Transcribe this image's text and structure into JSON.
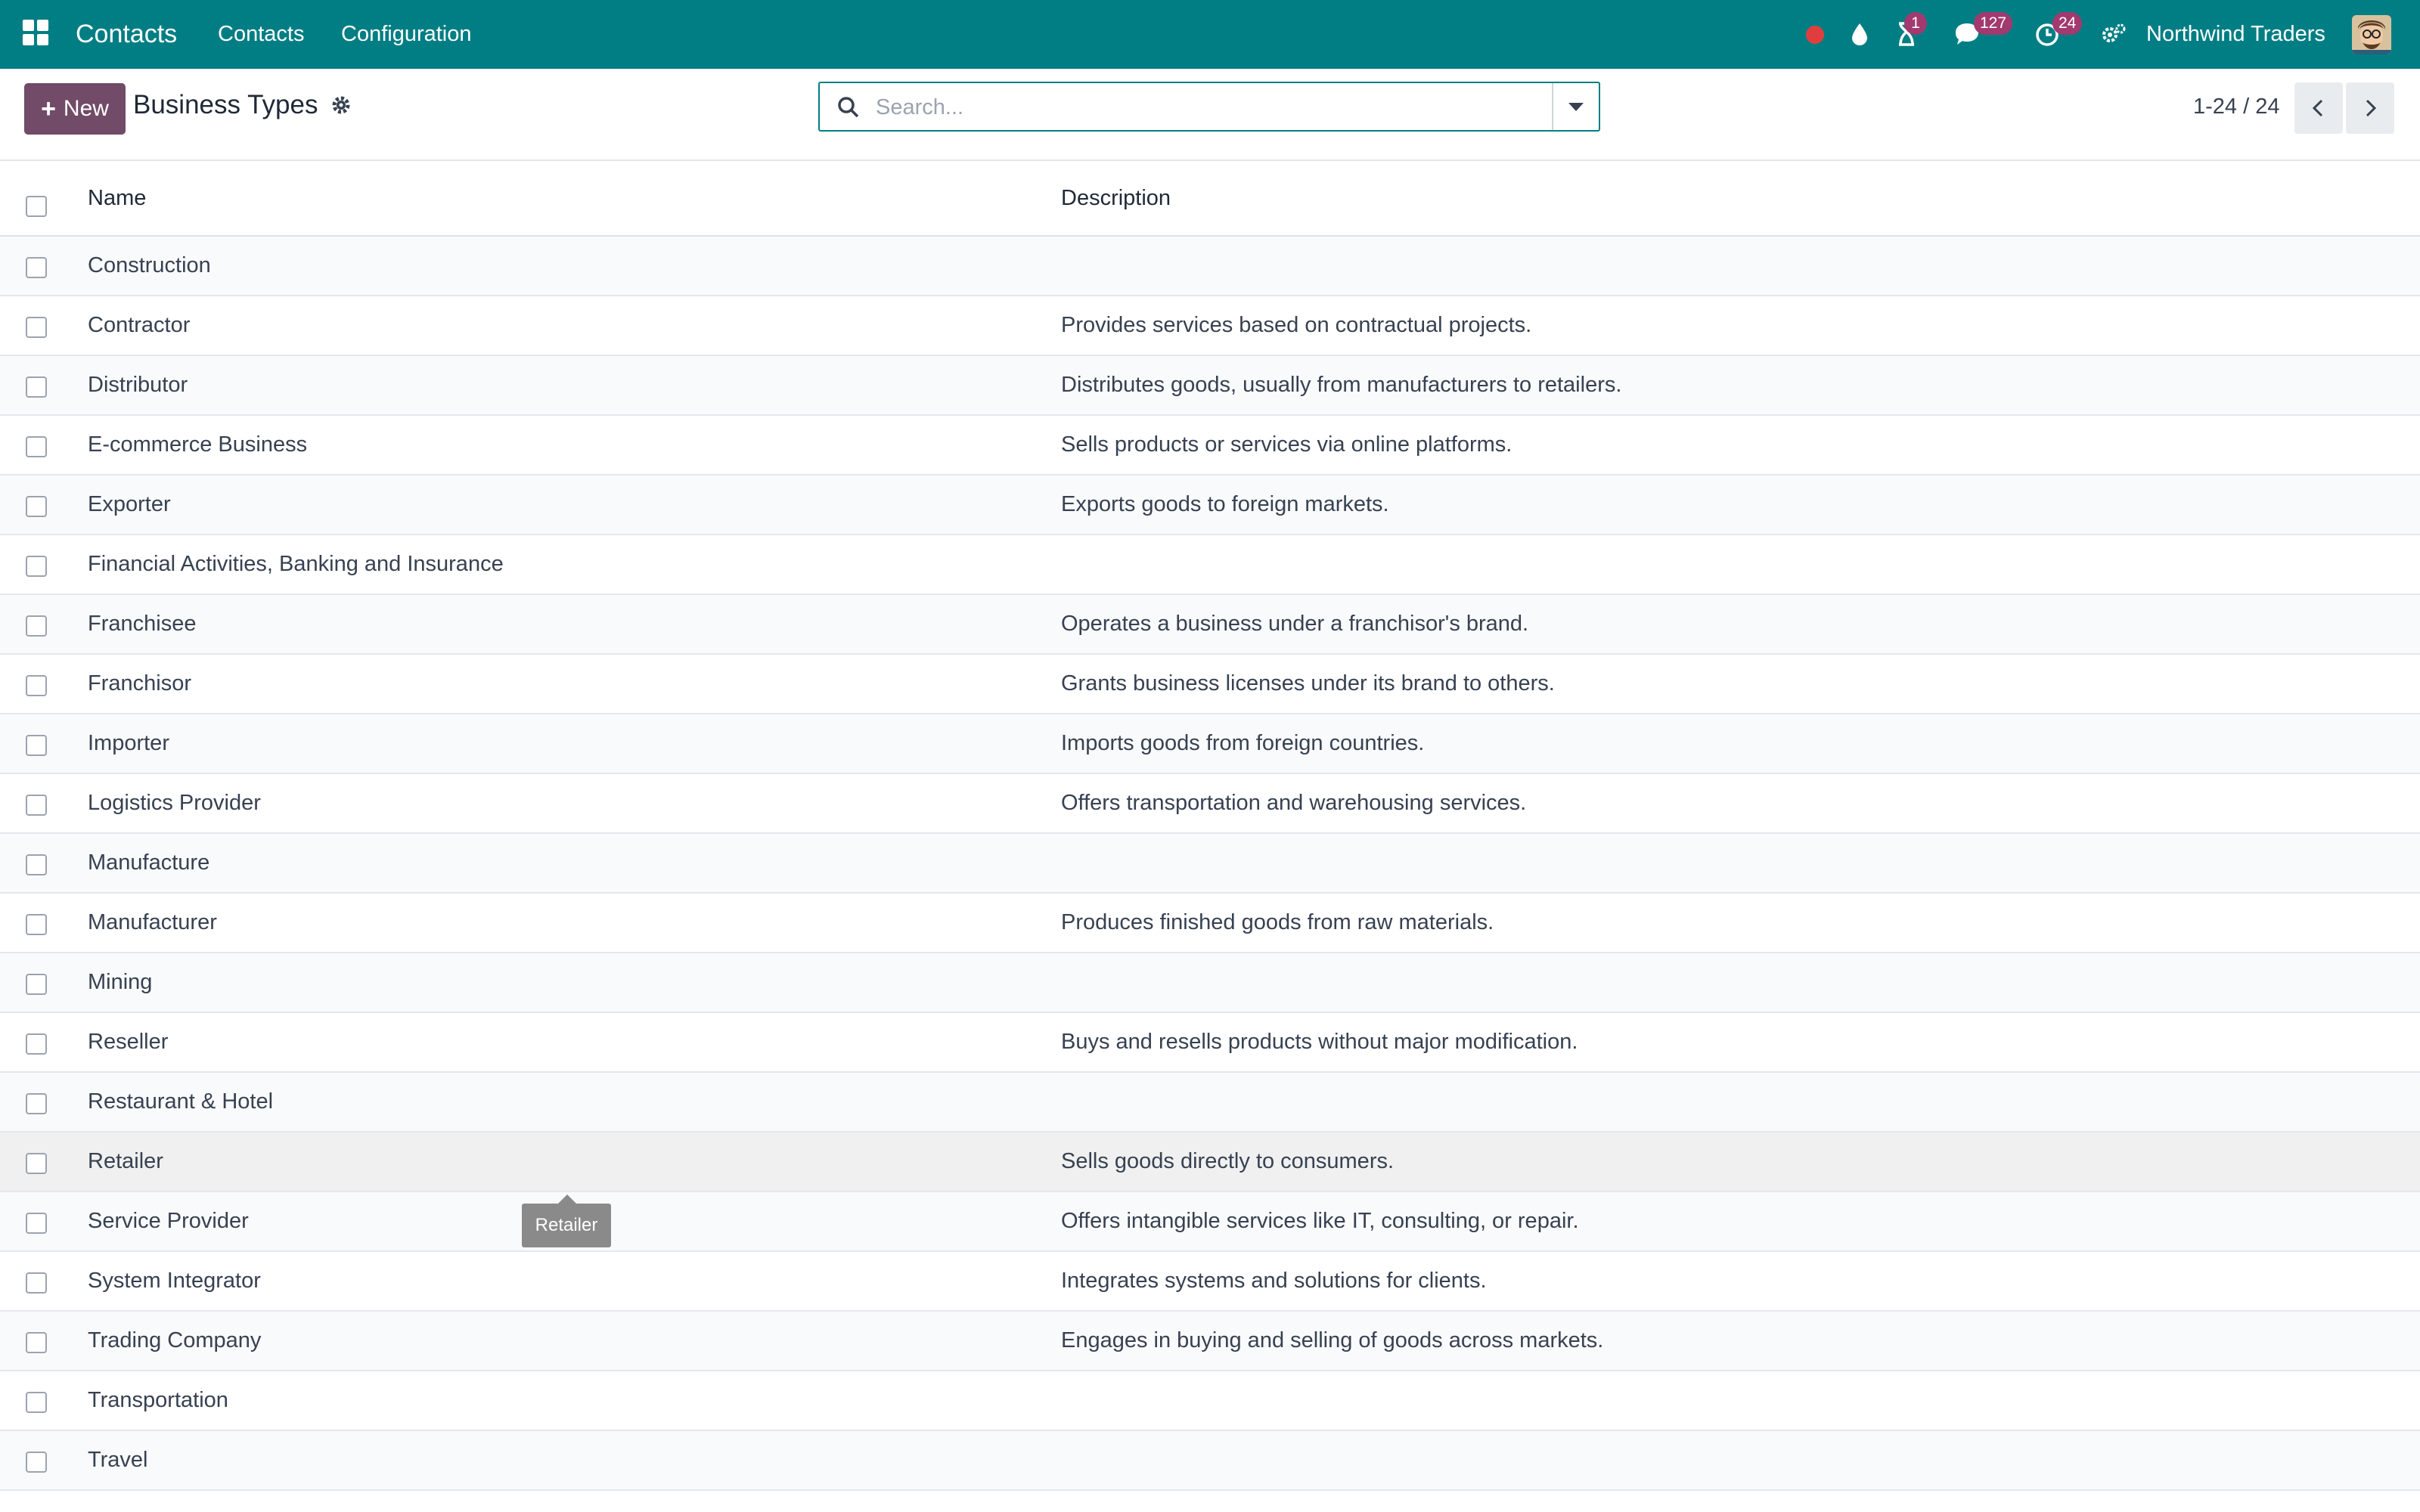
{
  "navbar": {
    "app_name": "Contacts",
    "menu": [
      "Contacts",
      "Configuration"
    ],
    "badges": {
      "activity": "1",
      "messages": "127",
      "clock": "24"
    },
    "company": "Northwind Traders",
    "colors": {
      "bar": "#017e84",
      "badge": "#a2396f",
      "recording": "#e03e3e"
    }
  },
  "control": {
    "new_label": "New",
    "title": "Business Types",
    "search_placeholder": "Search...",
    "pager": "1-24 / 24"
  },
  "table": {
    "columns": [
      "Name",
      "Description"
    ],
    "rows": [
      {
        "name": "Construction",
        "description": ""
      },
      {
        "name": "Contractor",
        "description": "Provides services based on contractual projects."
      },
      {
        "name": "Distributor",
        "description": "Distributes goods, usually from manufacturers to retailers."
      },
      {
        "name": "E-commerce Business",
        "description": "Sells products or services via online platforms."
      },
      {
        "name": "Exporter",
        "description": "Exports goods to foreign markets."
      },
      {
        "name": "Financial Activities, Banking and Insurance",
        "description": ""
      },
      {
        "name": "Franchisee",
        "description": "Operates a business under a franchisor's brand."
      },
      {
        "name": "Franchisor",
        "description": "Grants business licenses under its brand to others."
      },
      {
        "name": "Importer",
        "description": "Imports goods from foreign countries."
      },
      {
        "name": "Logistics Provider",
        "description": "Offers transportation and warehousing services."
      },
      {
        "name": "Manufacture",
        "description": ""
      },
      {
        "name": "Manufacturer",
        "description": "Produces finished goods from raw materials."
      },
      {
        "name": "Mining",
        "description": ""
      },
      {
        "name": "Reseller",
        "description": "Buys and resells products without major modification."
      },
      {
        "name": "Restaurant & Hotel",
        "description": ""
      },
      {
        "name": "Retailer",
        "description": "Sells goods directly to consumers."
      },
      {
        "name": "Service Provider",
        "description": "Offers intangible services like IT, consulting, or repair."
      },
      {
        "name": "System Integrator",
        "description": "Integrates systems and solutions for clients."
      },
      {
        "name": "Trading Company",
        "description": "Engages in buying and selling of goods across markets."
      },
      {
        "name": "Transportation",
        "description": ""
      },
      {
        "name": "Travel",
        "description": ""
      }
    ]
  },
  "tooltip": "Retailer"
}
